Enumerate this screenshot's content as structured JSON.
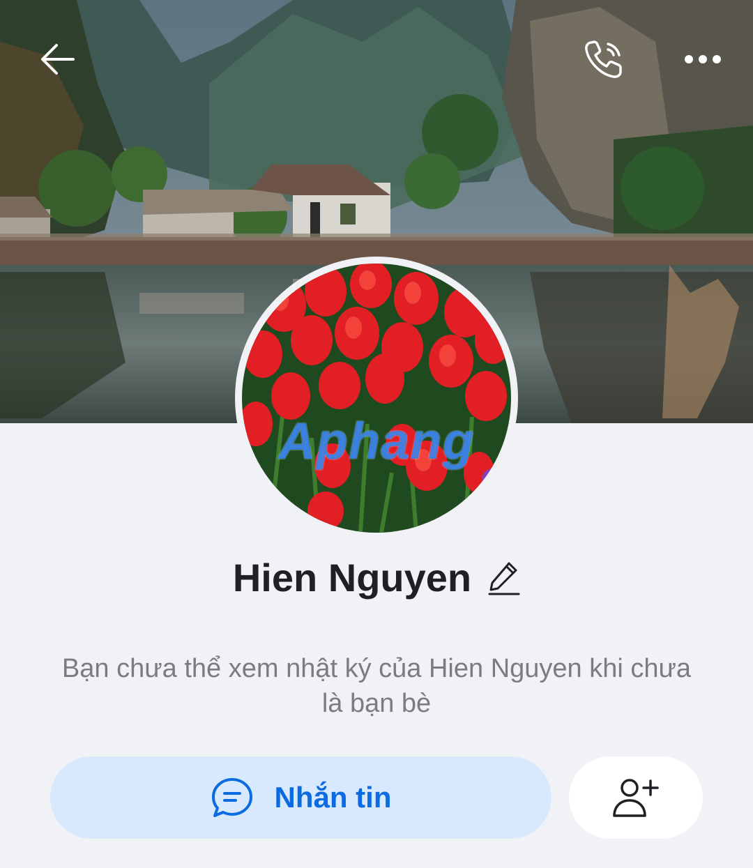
{
  "profile": {
    "name": "Hien Nguyen",
    "avatar_watermark": "Aphang",
    "notice": "Bạn chưa thể xem nhật ký của Hien Nguyen khi chưa là bạn bè"
  },
  "actions": {
    "message_label": "Nhắn tin"
  },
  "icons": {
    "back": "arrow-left-icon",
    "call": "phone-icon",
    "more": "more-dots-icon",
    "edit": "pencil-icon",
    "chat": "chat-bubble-icon",
    "add_friend": "add-person-icon"
  },
  "colors": {
    "page_bg": "#f1f2f6",
    "accent": "#0b6be0",
    "message_button_bg": "#d9e9fd",
    "name_text": "#1f1f24",
    "notice_text": "#7b7c82"
  }
}
